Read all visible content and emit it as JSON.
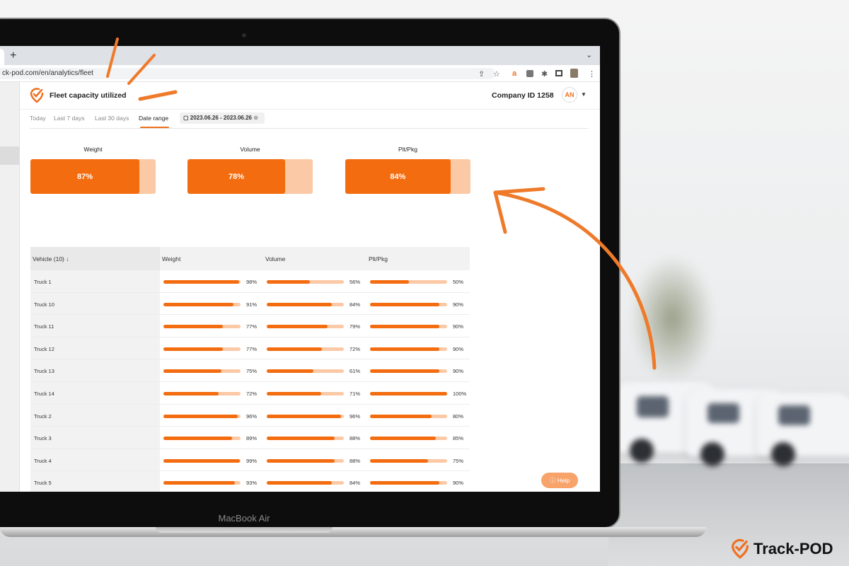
{
  "browser": {
    "url": "ck-pod.com/en/analytics/fleet",
    "new_tab": "+"
  },
  "app": {
    "title": "Fleet capacity utilized",
    "company": "Company ID 1258",
    "avatar": "AN",
    "filters": [
      "Today",
      "Last 7 days",
      "Last 30 days",
      "Date range"
    ],
    "active_filter": "Date range",
    "date_range": "2023.06.26 - 2023.06.26",
    "summary": [
      {
        "label": "Weight",
        "value": 87,
        "text": "87%"
      },
      {
        "label": "Volume",
        "value": 78,
        "text": "78%"
      },
      {
        "label": "Plt/Pkg",
        "value": 84,
        "text": "84%"
      }
    ],
    "table": {
      "headers": [
        "Vehicle (10) ↓",
        "Weight",
        "Volume",
        "Plt/Pkg"
      ],
      "rows": [
        {
          "vehicle": "Truck 1",
          "weight": 98,
          "volume": 56,
          "plt": 50
        },
        {
          "vehicle": "Truck 10",
          "weight": 91,
          "volume": 84,
          "plt": 90
        },
        {
          "vehicle": "Truck 11",
          "weight": 77,
          "volume": 79,
          "plt": 90
        },
        {
          "vehicle": "Truck 12",
          "weight": 77,
          "volume": 72,
          "plt": 90
        },
        {
          "vehicle": "Truck 13",
          "weight": 75,
          "volume": 61,
          "plt": 90
        },
        {
          "vehicle": "Truck 14",
          "weight": 72,
          "volume": 71,
          "plt": 100
        },
        {
          "vehicle": "Truck 2",
          "weight": 96,
          "volume": 96,
          "plt": 80
        },
        {
          "vehicle": "Truck 3",
          "weight": 89,
          "volume": 88,
          "plt": 85
        },
        {
          "vehicle": "Truck 4",
          "weight": 99,
          "volume": 88,
          "plt": 75
        },
        {
          "vehicle": "Truck 5",
          "weight": 93,
          "volume": 84,
          "plt": 90
        }
      ]
    },
    "help": "Help"
  },
  "laptop_label": "MacBook Air",
  "brand": "Track-POD",
  "colors": {
    "accent": "#f36c0f",
    "accent_light": "#fcc9a6"
  }
}
